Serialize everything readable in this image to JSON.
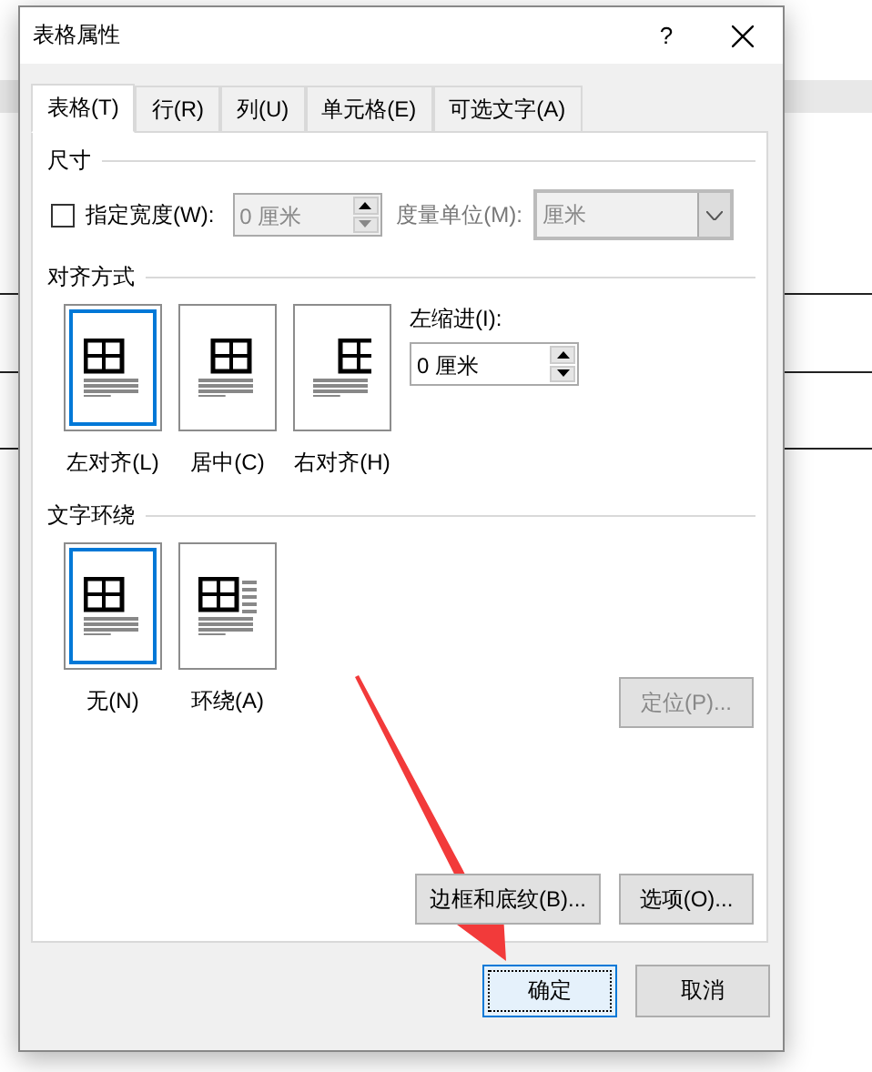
{
  "window": {
    "title": "表格属性",
    "help": "?"
  },
  "tabs": [
    {
      "label": "表格(T)",
      "selected": true
    },
    {
      "label": "行(R)",
      "selected": false
    },
    {
      "label": "列(U)",
      "selected": false
    },
    {
      "label": "单元格(E)",
      "selected": false
    },
    {
      "label": "可选文字(A)",
      "selected": false
    }
  ],
  "size": {
    "heading": "尺寸",
    "width_checkbox": {
      "label": "指定宽度(W):",
      "checked": false
    },
    "width_field": {
      "value": "0 厘米",
      "disabled": true
    },
    "unit_label": "度量单位(M):",
    "unit_select": {
      "value": "厘米",
      "disabled": true
    }
  },
  "alignment": {
    "heading": "对齐方式",
    "options": [
      {
        "label": "左对齐(L)",
        "kind": "left",
        "selected": true
      },
      {
        "label": "居中(C)",
        "kind": "center",
        "selected": false
      },
      {
        "label": "右对齐(H)",
        "kind": "right",
        "selected": false
      }
    ],
    "indent_label": "左缩进(I):",
    "indent_field": {
      "value": "0 厘米"
    }
  },
  "wrapping": {
    "heading": "文字环绕",
    "options": [
      {
        "label": "无(N)",
        "kind": "left",
        "selected": true
      },
      {
        "label": "环绕(A)",
        "kind": "around",
        "selected": false
      }
    ],
    "position_button": {
      "label": "定位(P)...",
      "disabled": true
    }
  },
  "panel_buttons": [
    "边框和底纹(B)...",
    "选项(O)..."
  ],
  "footer_buttons": [
    {
      "label": "确定",
      "default": true
    },
    {
      "label": "取消",
      "default": false
    }
  ]
}
